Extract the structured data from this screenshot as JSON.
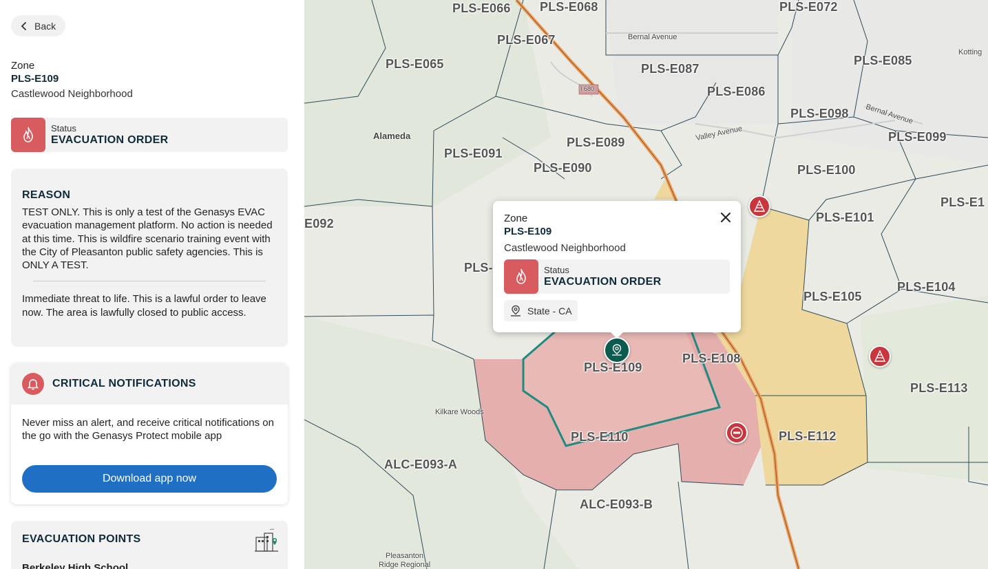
{
  "sidebar": {
    "back_label": "Back",
    "zone_label": "Zone",
    "zone_id": "PLS-E109",
    "zone_name": "Castlewood Neighborhood",
    "status_label": "Status",
    "status_value": "EVACUATION ORDER",
    "reason": {
      "title": "REASON",
      "text1": "TEST ONLY. This is only a test of the Genasys EVAC evacuation management platform. No action is needed at this time. This is wildfire scenario training event with the City of Pleasanton public safety agencies. This is ONLY A TEST.",
      "text2": "Immediate threat to life. This is a lawful order to leave now. The area is lawfully closed to public access."
    },
    "critical": {
      "title": "CRITICAL NOTIFICATIONS",
      "text": "Never miss an alert, and receive critical notifications on the go with the Genasys Protect mobile app",
      "button": "Download app now"
    },
    "evac_points": {
      "title": "EVACUATION POINTS",
      "first_item": "Berkeley High School"
    }
  },
  "map": {
    "zone_labels": [
      "PLS-E066",
      "PLS-E068",
      "PLS-E072",
      "PLS-E067",
      "PLS-E065",
      "PLS-E087",
      "PLS-E085",
      "PLS-E086",
      "PLS-E098",
      "PLS-E099",
      "PLS-E089",
      "PLS-E091",
      "PLS-E090",
      "PLS-E100",
      "PLS-E101",
      "PLS-E1",
      "E092",
      "PLS-",
      "PLS-E104",
      "PLS-E105",
      "PLS-E108",
      "PLS-E109",
      "PLS-E113",
      "PLS-E110",
      "PLS-E112",
      "ALC-E093-A",
      "ALC-E093-B"
    ],
    "place_labels": [
      "Bernal Avenue",
      "Bernal Avenue",
      "Valley Avenue",
      "Alameda",
      "I 680",
      "Kilkare Woods",
      "Pleasanton",
      "Ridge Regional",
      "Kotting"
    ],
    "colors": {
      "order": "#e3a9a6",
      "warning": "#eed592",
      "selected_outline": "#1f8a7f",
      "marker_red": "#c8363e",
      "marker_green": "#0d5a4f"
    }
  },
  "popup": {
    "zone_label": "Zone",
    "zone_id": "PLS-E109",
    "zone_name": "Castlewood Neighborhood",
    "status_label": "Status",
    "status_value": "EVACUATION ORDER",
    "state_chip": "State - CA"
  },
  "icons": {
    "back": "chevron-left-icon",
    "status": "fire-icon",
    "bell": "bell-icon",
    "close": "close-icon",
    "state": "location-pin-icon",
    "shelter": "shelter-icon",
    "road_closed": "road-closed-icon"
  }
}
